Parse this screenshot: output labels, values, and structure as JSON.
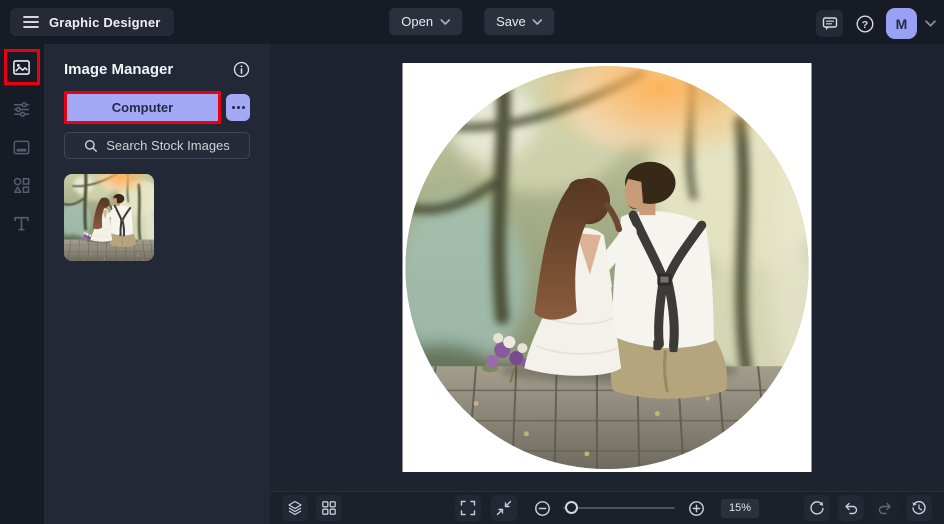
{
  "header": {
    "app_title": "Graphic Designer",
    "open_label": "Open",
    "save_label": "Save",
    "help_glyph": "?",
    "avatar_initial": "M"
  },
  "sidebar": {
    "items": [
      {
        "id": "image-manager",
        "icon": "image-icon",
        "active": true,
        "highlighted": true
      },
      {
        "id": "edit",
        "icon": "adjustments-icon",
        "active": false
      },
      {
        "id": "templates",
        "icon": "frame-icon",
        "active": false
      },
      {
        "id": "graphics",
        "icon": "shapes-icon",
        "active": false
      },
      {
        "id": "text",
        "icon": "text-icon",
        "active": false
      }
    ]
  },
  "panel": {
    "title": "Image Manager",
    "computer_button_label": "Computer",
    "search_label": "Search Stock Images",
    "thumbnail": "wedding-couple-photo"
  },
  "canvas": {
    "content": "circular cropped photo of a seated couple on a white square canvas"
  },
  "toolbar": {
    "zoom_value": "15%",
    "left_icons": [
      "layers-icon",
      "grid-icon"
    ],
    "center_icons": [
      "fullscreen-icon",
      "fit-screen-icon",
      "zoom-out-icon",
      "zoom-slider",
      "zoom-in-icon"
    ],
    "right_icons": [
      "reset-icon",
      "undo-icon",
      "redo-icon",
      "history-icon"
    ]
  },
  "annotations": {
    "color": "#e80013",
    "targets": [
      "image-manager-sidebar-icon",
      "computer-button"
    ]
  },
  "colors": {
    "accent_purple": "#a4a9f5",
    "top_bar": "#171b26",
    "panel": "#232836",
    "canvas_area": "#1e2330",
    "canvas": "#ffffff",
    "annotation_red": "#e80013"
  }
}
